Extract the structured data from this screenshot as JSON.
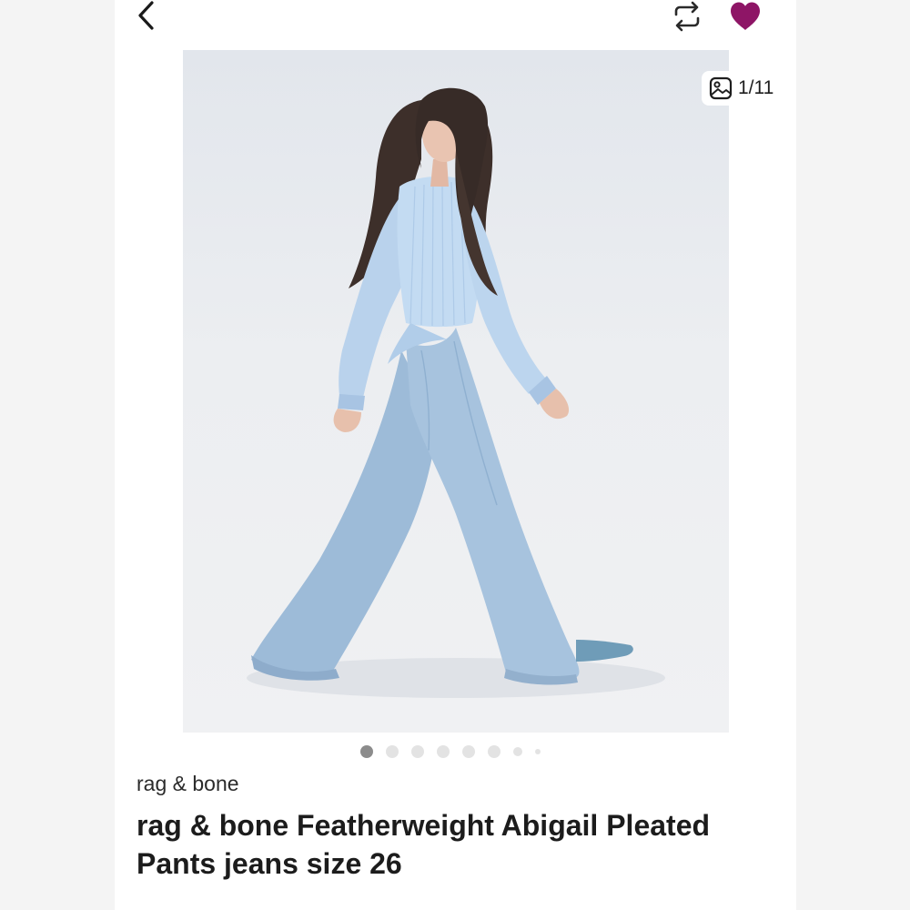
{
  "header": {
    "back_icon": "chevron-left-icon",
    "repost_icon": "repost-icon",
    "like_icon": "heart-icon",
    "like_color": "#8e1566"
  },
  "gallery": {
    "counter_icon": "image-icon",
    "counter_text": "1/11",
    "total_dots": 8,
    "active_dot": 1
  },
  "listing": {
    "brand": "rag & bone",
    "title": "rag & bone Featherweight Abigail Pleated Pants jeans size 26"
  }
}
